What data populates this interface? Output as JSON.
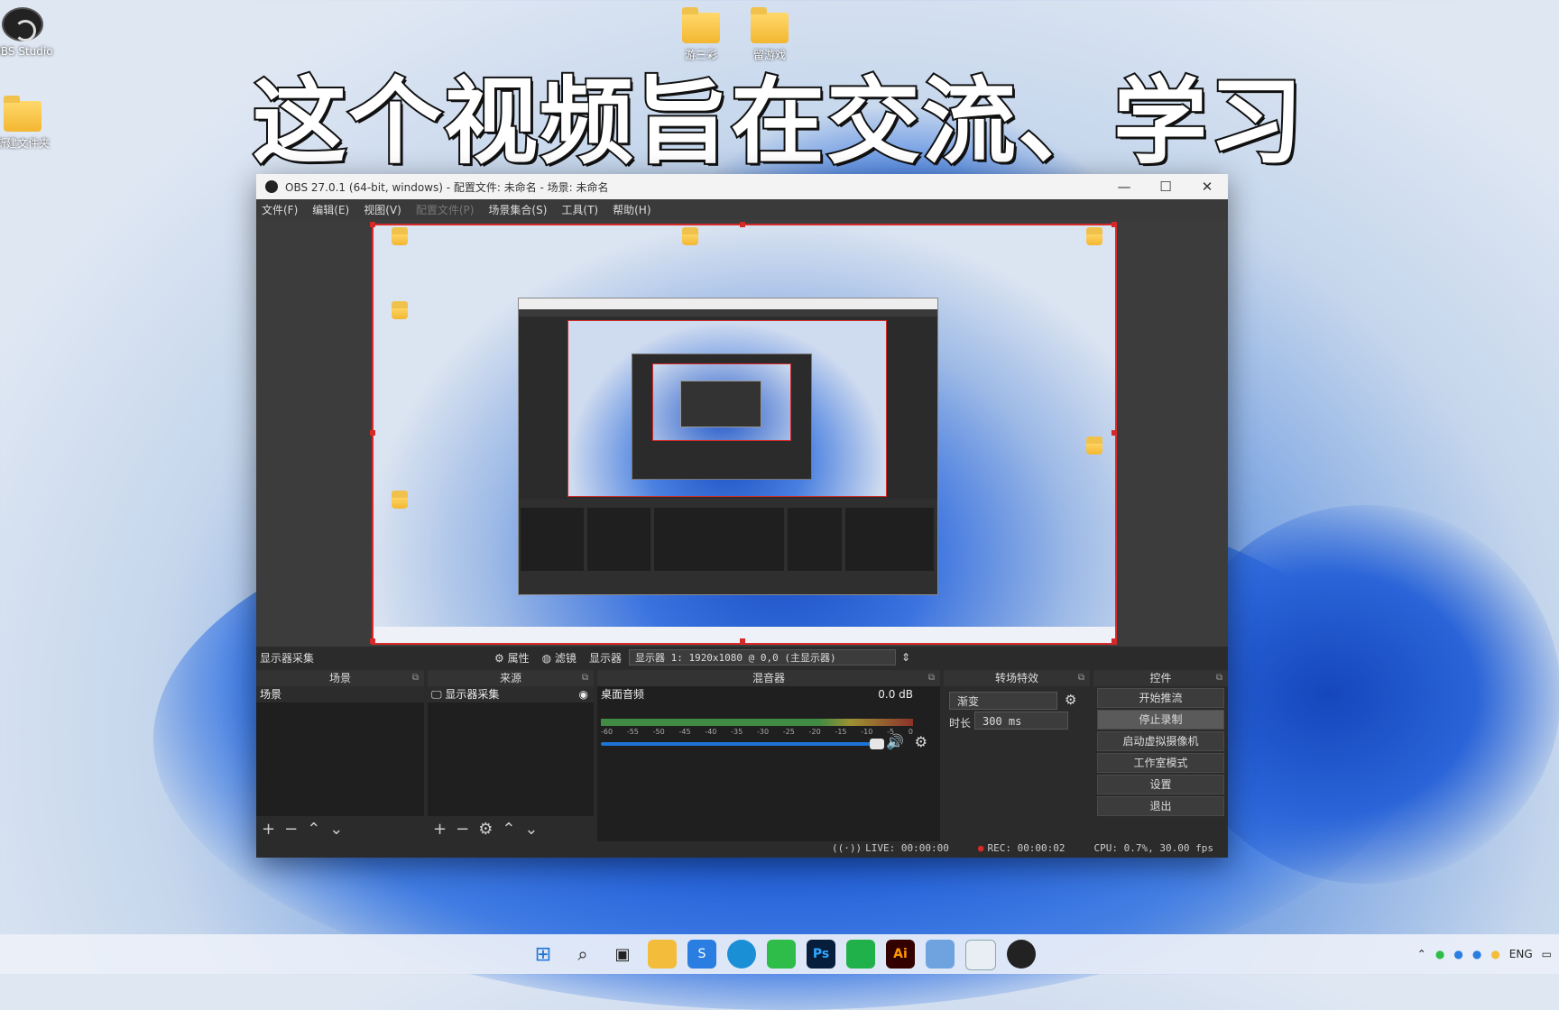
{
  "headline": "这个视频旨在交流、学习",
  "desktop": {
    "icons": [
      {
        "label": "OBS Studio",
        "type": "obs"
      },
      {
        "label": "新建文件夹",
        "type": "folder"
      },
      {
        "label": "游三彩",
        "type": "folder"
      },
      {
        "label": "留游戏",
        "type": "folder"
      }
    ]
  },
  "window": {
    "title": "OBS 27.0.1 (64-bit, windows) - 配置文件: 未命名 - 场景: 未命名",
    "controls": {
      "minimize": "—",
      "maximize": "☐",
      "close": "✕"
    },
    "menu": [
      "文件(F)",
      "编辑(E)",
      "视图(V)",
      "配置文件(P)",
      "场景集合(S)",
      "工具(T)",
      "帮助(H)"
    ],
    "menu_disabled_index": 3
  },
  "source_bar": {
    "source_name": "显示器采集",
    "properties": "属性",
    "filters": "滤镜",
    "display_label": "显示器",
    "display_value": "显示器 1: 1920x1080 @ 0,0 (主显示器)"
  },
  "docks": {
    "scenes": {
      "title": "场景",
      "items": [
        "场景"
      ]
    },
    "sources": {
      "title": "来源",
      "items": [
        "显示器采集"
      ]
    },
    "mixer": {
      "title": "混音器",
      "channel": "桌面音频",
      "level": "0.0 dB",
      "ticks": [
        "-60",
        "-55",
        "-50",
        "-45",
        "-40",
        "-35",
        "-30",
        "-25",
        "-20",
        "-15",
        "-10",
        "-5",
        "0"
      ]
    },
    "transitions": {
      "title": "转场特效",
      "type": "渐变",
      "duration_label": "时长",
      "duration_value": "300 ms"
    },
    "controls": {
      "title": "控件",
      "buttons": [
        "开始推流",
        "停止录制",
        "启动虚拟摄像机",
        "工作室模式",
        "设置",
        "退出"
      ],
      "active_index": 1
    }
  },
  "status": {
    "live": "LIVE: 00:00:00",
    "rec": "REC: 00:00:02",
    "cpu": "CPU: 0.7%, 30.00 fps"
  },
  "taskbar": {
    "apps": [
      "start-icon",
      "search-icon",
      "task-view-icon",
      "file-explorer-icon",
      "store-icon",
      "edge-icon",
      "wechat-icon",
      "photoshop-icon",
      "green-app-icon",
      "illustrator-icon",
      "image-viewer-icon",
      "notepad-icon",
      "obs-icon"
    ],
    "app_labels": {
      "photoshop": "Ps",
      "illustrator": "Ai",
      "store": "S"
    },
    "tray_lang": "ENG"
  }
}
